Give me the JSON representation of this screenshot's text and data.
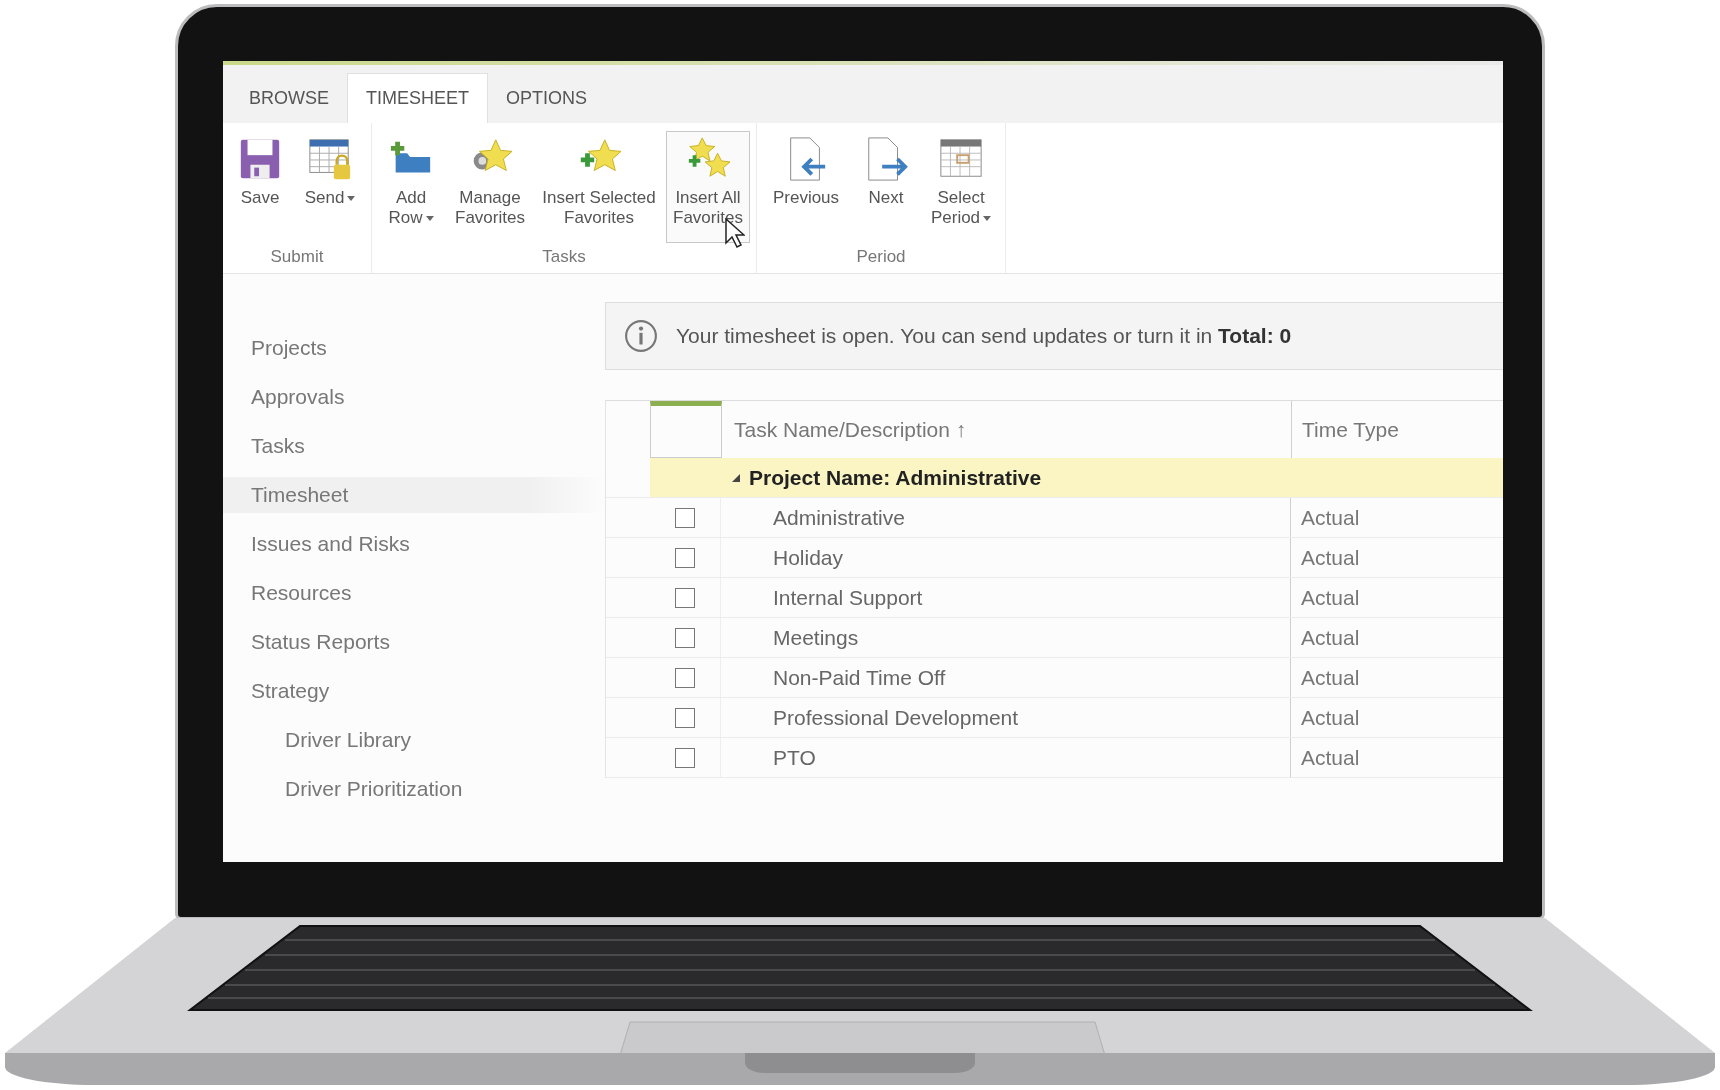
{
  "tabs": [
    {
      "label": "BROWSE",
      "selected": false
    },
    {
      "label": "TIMESHEET",
      "selected": true
    },
    {
      "label": "OPTIONS",
      "selected": false
    }
  ],
  "ribbon": {
    "groups": [
      {
        "label": "Submit",
        "buttons": [
          {
            "kind": "save",
            "label": "Save",
            "dropdown": false,
            "hovered": false
          },
          {
            "kind": "send",
            "label": "Send",
            "dropdown": true,
            "hovered": false
          }
        ]
      },
      {
        "label": "Tasks",
        "buttons": [
          {
            "kind": "add-row",
            "label": "Add Row",
            "dropdown": true,
            "hovered": false
          },
          {
            "kind": "manage-favorites",
            "label": "Manage Favorites",
            "dropdown": false,
            "hovered": false
          },
          {
            "kind": "insert-selected",
            "label": "Insert Selected Favorites",
            "dropdown": false,
            "hovered": false
          },
          {
            "kind": "insert-all",
            "label": "Insert All Favorites",
            "dropdown": false,
            "hovered": true
          }
        ]
      },
      {
        "label": "Period",
        "buttons": [
          {
            "kind": "previous",
            "label": "Previous",
            "dropdown": false,
            "hovered": false
          },
          {
            "kind": "next",
            "label": "Next",
            "dropdown": false,
            "hovered": false
          },
          {
            "kind": "select-period",
            "label": "Select Period",
            "dropdown": true,
            "hovered": false
          }
        ]
      }
    ]
  },
  "navigation": {
    "items": [
      {
        "label": "Projects",
        "selected": false
      },
      {
        "label": "Approvals",
        "selected": false
      },
      {
        "label": "Tasks",
        "selected": false
      },
      {
        "label": "Timesheet",
        "selected": true
      },
      {
        "label": "Issues and Risks",
        "selected": false
      },
      {
        "label": "Resources",
        "selected": false
      },
      {
        "label": "Status Reports",
        "selected": false
      },
      {
        "label": "Strategy",
        "selected": false,
        "children": [
          {
            "label": "Driver Library",
            "selected": false
          },
          {
            "label": "Driver Prioritization",
            "selected": false
          }
        ]
      }
    ]
  },
  "notice": {
    "text": "Your timesheet is open. You can send updates or turn it in **Total: 0**"
  },
  "timesheet": {
    "columns": [
      {
        "label": "Task Name/Description",
        "sort_mark": "↑"
      },
      {
        "label": "Time Type"
      }
    ],
    "group": {
      "label": "Project Name: Administrative",
      "expanded": true
    },
    "rows": [
      {
        "task": "Administrative",
        "time_type": "Actual",
        "checked": false
      },
      {
        "task": "Holiday",
        "time_type": "Actual",
        "checked": false
      },
      {
        "task": "Internal Support",
        "time_type": "Actual",
        "checked": false
      },
      {
        "task": "Meetings",
        "time_type": "Actual",
        "checked": false
      },
      {
        "task": "Non-Paid Time Off",
        "time_type": "Actual",
        "checked": false
      },
      {
        "task": "Professional Development",
        "time_type": "Actual",
        "checked": false
      },
      {
        "task": "PTO",
        "time_type": "Actual",
        "checked": false
      }
    ]
  }
}
